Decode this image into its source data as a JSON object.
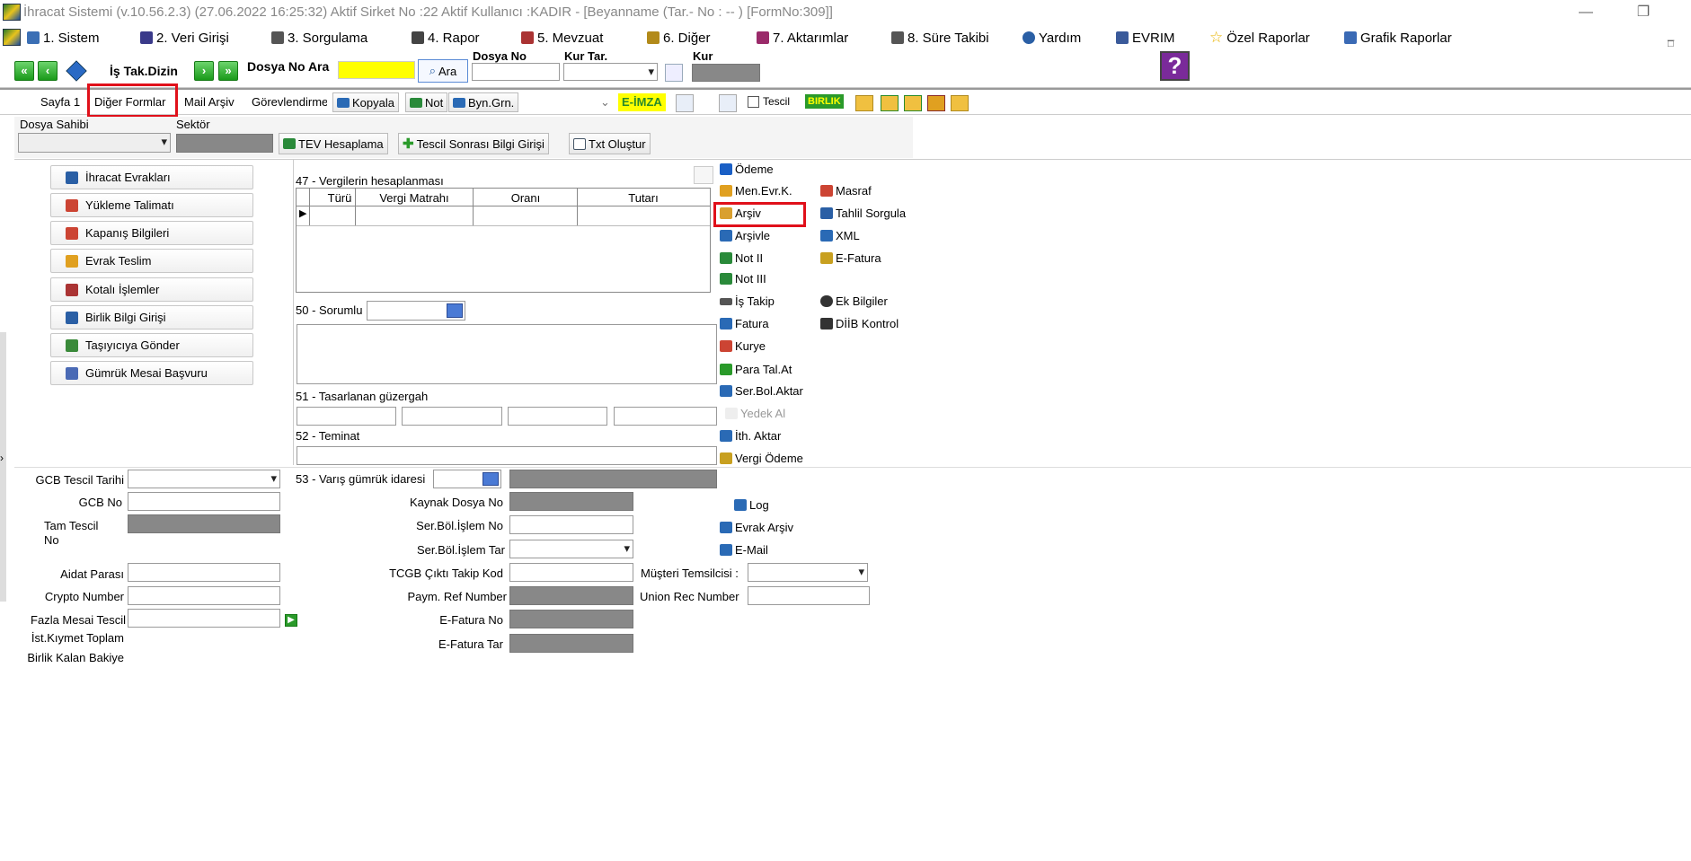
{
  "window": {
    "title": "İhracat Sistemi (v.10.56.2.3) (27.06.2022 16:25:32) Aktif Sirket No :22 Aktif Kullanıcı :KADIR - [Beyanname (Tar.- No :  --  )  [FormNo:309]]",
    "minimize_label": "—",
    "restore_label": "❐"
  },
  "menu": {
    "items": [
      {
        "label": "1.   Sistem",
        "icon": "computer-icon",
        "color": "#3b6fb5"
      },
      {
        "label": "2.   Veri Girişi",
        "icon": "edit-icon",
        "color": "#3a3a8a"
      },
      {
        "label": "3.   Sorgulama",
        "icon": "query-icon",
        "color": "#555"
      },
      {
        "label": "4.   Rapor",
        "icon": "printer-icon",
        "color": "#444"
      },
      {
        "label": "5.   Mevzuat",
        "icon": "books-icon",
        "color": "#a33"
      },
      {
        "label": "6.   Diğer",
        "icon": "tools-icon",
        "color": "#b28a1a"
      },
      {
        "label": "7.   Aktarımlar",
        "icon": "transfer-icon",
        "color": "#9a2a6a"
      },
      {
        "label": "8. Süre Takibi",
        "icon": "clock-icon",
        "color": "#555"
      },
      {
        "label": "Yardım",
        "icon": "anchor-icon",
        "color": "#2a5fa5"
      },
      {
        "label": "EVRIM",
        "icon": "book-icon",
        "color": "#3a5a9a"
      },
      {
        "label": "Özel Raporlar",
        "icon": "star-icon",
        "color": "#e8b400"
      },
      {
        "label": "Grafik Raporlar",
        "icon": "chart-icon",
        "color": "#3a6ab5"
      }
    ],
    "right_controls": [
      "_",
      "□"
    ]
  },
  "toolbar": {
    "is_tak_dizin": "İş Tak.Dizin",
    "dosya_no_ara": "Dosya No Ara",
    "ara_button": "Ara",
    "dosya_no_label": "Dosya No",
    "kur_tar_label": "Kur Tar.",
    "kur_label": "Kur",
    "help_glyph": "?"
  },
  "tabs": {
    "items": [
      "Sayfa 1",
      "Diğer Formlar",
      "Mail Arşiv",
      "Görevlendirme"
    ],
    "buttons": [
      "Kopyala",
      "Not",
      "Byn.Grn."
    ],
    "eimza": "E-İMZA",
    "tescil": "Tescil",
    "birlik": "BIRLIK"
  },
  "header_fields": {
    "dosya_sahibi": "Dosya Sahibi",
    "sektor": "Sektör",
    "tev_button": "TEV Hesaplama",
    "tescil_sonrasi_button": "Tescil Sonrası Bilgi Girişi",
    "txt_button": "Txt Oluştur"
  },
  "side_buttons": [
    {
      "label": "İhracat Evrakları",
      "icon": "document-icon",
      "color": "#2a5fa5"
    },
    {
      "label": "Yükleme Talimatı",
      "icon": "truck-icon",
      "color": "#c43"
    },
    {
      "label": "Kapanış Bilgileri",
      "icon": "close-doc-icon",
      "color": "#c43"
    },
    {
      "label": "Evrak Teslim",
      "icon": "folder-icon",
      "color": "#e0a020"
    },
    {
      "label": "Kotalı İşlemler",
      "icon": "calculator-icon",
      "color": "#a33"
    },
    {
      "label": "Birlik Bilgi Girişi",
      "icon": "building-icon",
      "color": "#2a5fa5"
    },
    {
      "label": "Taşıyıcıya Gönder",
      "icon": "truck-icon",
      "color": "#3a8a3a"
    },
    {
      "label": "Gümrük Mesai Başvuru",
      "icon": "pencil-doc-icon",
      "color": "#4a6ab5"
    }
  ],
  "vergi": {
    "title": "47 - Vergilerin hesaplanması",
    "columns": [
      "Türü",
      "Vergi Matrahı",
      "Oranı",
      "Tutarı"
    ]
  },
  "sorumlu": {
    "label": "50 - Sorumlu"
  },
  "guzergah": {
    "label": "51 - Tasarlanan güzergah"
  },
  "teminat": {
    "label": "52 - Teminat"
  },
  "varis": {
    "label": "53 - Varış gümrük idaresi"
  },
  "left_fields": [
    "GCB Tescil Tarihi",
    "GCB No",
    "Tam Tescil No",
    "Aidat Parası",
    "Crypto Number",
    "Fazla Mesai Tescil",
    "İst.Kıymet Toplam",
    "Birlik Kalan Bakiye"
  ],
  "mid_fields": [
    "Kaynak Dosya No",
    "Ser.Böl.İşlem No",
    "Ser.Böl.İşlem Tar",
    "TCGB Çıktı Takip Kod",
    "Paym. Ref Number",
    "E-Fatura No",
    "E-Fatura Tar"
  ],
  "right_fields": [
    "Müşteri Temsilcisi :",
    "Union Rec Number"
  ],
  "links_col1": [
    {
      "label": "Ödeme",
      "icon": "minus-icon",
      "color": "#1a5fc5"
    },
    {
      "label": "Men.Evr.K.",
      "icon": "envelope-icon",
      "color": "#e0a020"
    },
    {
      "label": "Arşiv",
      "icon": "archive-icon",
      "color": "#d9a030"
    },
    {
      "label": "Arşivle",
      "icon": "archive-add-icon",
      "color": "#2a6ab5"
    },
    {
      "label": "Not II",
      "icon": "note-icon",
      "color": "#2a8a3a"
    },
    {
      "label": "Not III",
      "icon": "note-icon",
      "color": "#2a8a3a"
    },
    {
      "label": "İş Takip",
      "icon": "keyboard-icon",
      "color": "#555"
    },
    {
      "label": "Fatura",
      "icon": "invoice-icon",
      "color": "#2a6ab5"
    },
    {
      "label": "Kurye",
      "icon": "courier-icon",
      "color": "#c43"
    },
    {
      "label": "Para Tal.At",
      "icon": "arrow-right-icon",
      "color": "#2a9a2a"
    },
    {
      "label": "Ser.Bol.Aktar",
      "icon": "transfer-icon",
      "color": "#2a6ab5"
    },
    {
      "label": "Yedek Al",
      "icon": "backup-icon",
      "color": "#bbb"
    },
    {
      "label": "İth. Aktar",
      "icon": "import-icon",
      "color": "#2a6ab5"
    },
    {
      "label": "Vergi Ödeme",
      "icon": "tax-icon",
      "color": "#c8a020"
    }
  ],
  "links_col2": [
    {
      "label": "Masraf",
      "icon": "box-icon",
      "color": "#c43"
    },
    {
      "label": "Tahlil Sorgula",
      "icon": "database-icon",
      "color": "#2a5fa5"
    },
    {
      "label": "XML",
      "icon": "xml-icon",
      "color": "#2a6ab5"
    },
    {
      "label": "E-Fatura",
      "icon": "efatura-icon",
      "color": "#c8a020"
    },
    {
      "label": "Ek Bilgiler",
      "icon": "info-icon",
      "color": "#333"
    },
    {
      "label": "DİİB Kontrol",
      "icon": "check-doc-icon",
      "color": "#333"
    }
  ],
  "links_bottom": [
    {
      "label": "Log",
      "icon": "log-icon",
      "color": "#2a6ab5"
    },
    {
      "label": "Evrak Arşiv",
      "icon": "archive-icon",
      "color": "#2a6ab5"
    },
    {
      "label": "E-Mail",
      "icon": "email-icon",
      "color": "#2a6ab5"
    }
  ],
  "colors": {
    "highlight_red": "#e0101a",
    "search_yellow": "#ffff00",
    "field_grey": "#888888",
    "eimza_bg": "#ffff00",
    "eimza_text": "#2a8a2a",
    "birlik_bg": "#2a9a2a",
    "birlik_text": "#ffff00"
  }
}
